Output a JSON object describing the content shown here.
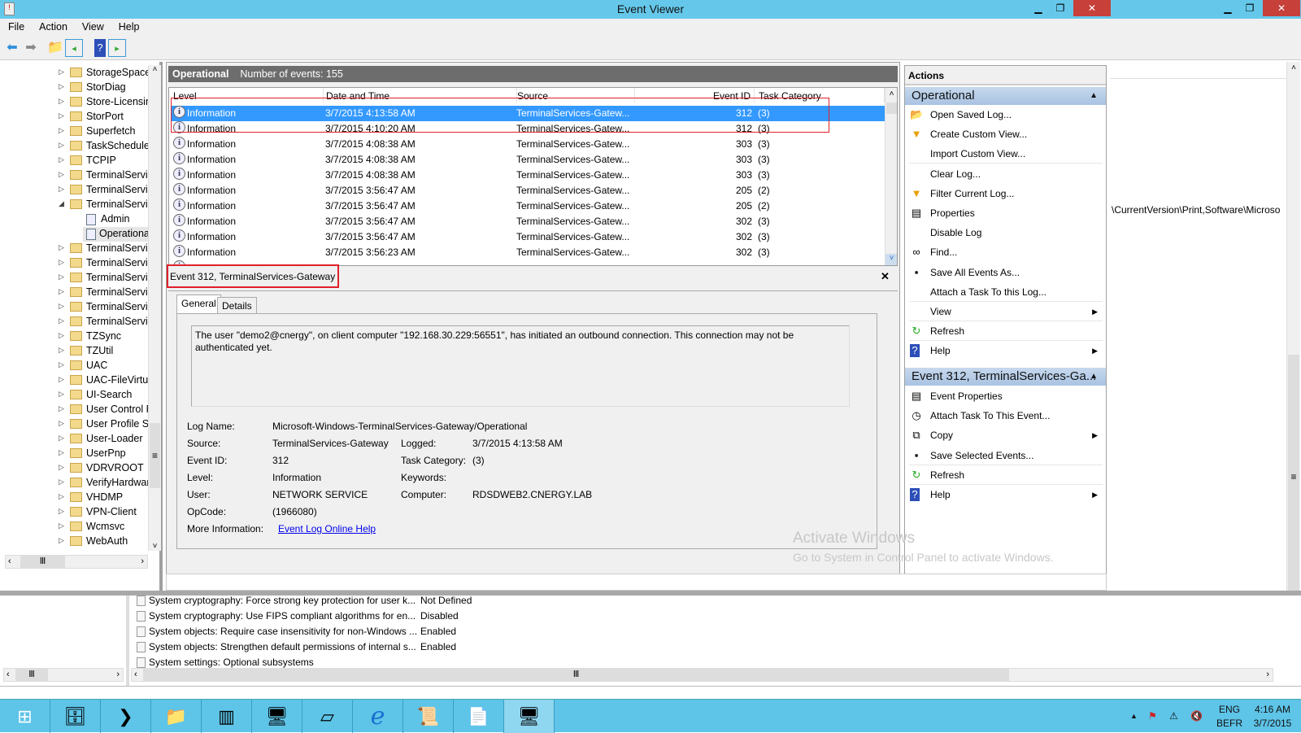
{
  "window": {
    "title": "Event Viewer"
  },
  "menu": [
    "File",
    "Action",
    "View",
    "Help"
  ],
  "tree": [
    {
      "label": "StorageSpaces",
      "kind": "folder"
    },
    {
      "label": "StorDiag",
      "kind": "folder"
    },
    {
      "label": "Store-Licensin",
      "kind": "folder"
    },
    {
      "label": "StorPort",
      "kind": "folder"
    },
    {
      "label": "Superfetch",
      "kind": "folder"
    },
    {
      "label": "TaskScheduler",
      "kind": "folder"
    },
    {
      "label": "TCPIP",
      "kind": "folder"
    },
    {
      "label": "TerminalServic",
      "kind": "folder"
    },
    {
      "label": "TerminalServic",
      "kind": "folder"
    },
    {
      "label": "TerminalServic",
      "kind": "folder-open"
    },
    {
      "label": "Admin",
      "kind": "log"
    },
    {
      "label": "Operationa",
      "kind": "log-selected"
    },
    {
      "label": "TerminalServic",
      "kind": "folder"
    },
    {
      "label": "TerminalServic",
      "kind": "folder"
    },
    {
      "label": "TerminalServic",
      "kind": "folder"
    },
    {
      "label": "TerminalServic",
      "kind": "folder"
    },
    {
      "label": "TerminalServic",
      "kind": "folder"
    },
    {
      "label": "TerminalServic",
      "kind": "folder"
    },
    {
      "label": "TZSync",
      "kind": "folder"
    },
    {
      "label": "TZUtil",
      "kind": "folder"
    },
    {
      "label": "UAC",
      "kind": "folder"
    },
    {
      "label": "UAC-FileVirtua",
      "kind": "folder"
    },
    {
      "label": "UI-Search",
      "kind": "folder"
    },
    {
      "label": "User Control P",
      "kind": "folder"
    },
    {
      "label": "User Profile Se",
      "kind": "folder"
    },
    {
      "label": "User-Loader",
      "kind": "folder"
    },
    {
      "label": "UserPnp",
      "kind": "folder"
    },
    {
      "label": "VDRVROOT",
      "kind": "folder"
    },
    {
      "label": "VerifyHardwar",
      "kind": "folder"
    },
    {
      "label": "VHDMP",
      "kind": "folder"
    },
    {
      "label": "VPN-Client",
      "kind": "folder"
    },
    {
      "label": "Wcmsvc",
      "kind": "folder"
    },
    {
      "label": "WebAuth",
      "kind": "folder"
    }
  ],
  "log": {
    "name": "Operational",
    "count_text": "Number of events: 155"
  },
  "columns": [
    "Level",
    "Date and Time",
    "Source",
    "Event ID",
    "Task Category"
  ],
  "events": [
    {
      "level": "Information",
      "date": "3/7/2015 4:13:58 AM",
      "source": "TerminalServices-Gatew...",
      "id": "312",
      "cat": "(3)"
    },
    {
      "level": "Information",
      "date": "3/7/2015 4:10:20 AM",
      "source": "TerminalServices-Gatew...",
      "id": "312",
      "cat": "(3)"
    },
    {
      "level": "Information",
      "date": "3/7/2015 4:08:38 AM",
      "source": "TerminalServices-Gatew...",
      "id": "303",
      "cat": "(3)"
    },
    {
      "level": "Information",
      "date": "3/7/2015 4:08:38 AM",
      "source": "TerminalServices-Gatew...",
      "id": "303",
      "cat": "(3)"
    },
    {
      "level": "Information",
      "date": "3/7/2015 4:08:38 AM",
      "source": "TerminalServices-Gatew...",
      "id": "303",
      "cat": "(3)"
    },
    {
      "level": "Information",
      "date": "3/7/2015 3:56:47 AM",
      "source": "TerminalServices-Gatew...",
      "id": "205",
      "cat": "(2)"
    },
    {
      "level": "Information",
      "date": "3/7/2015 3:56:47 AM",
      "source": "TerminalServices-Gatew...",
      "id": "205",
      "cat": "(2)"
    },
    {
      "level": "Information",
      "date": "3/7/2015 3:56:47 AM",
      "source": "TerminalServices-Gatew...",
      "id": "302",
      "cat": "(3)"
    },
    {
      "level": "Information",
      "date": "3/7/2015 3:56:47 AM",
      "source": "TerminalServices-Gatew...",
      "id": "302",
      "cat": "(3)"
    },
    {
      "level": "Information",
      "date": "3/7/2015 3:56:23 AM",
      "source": "TerminalServices-Gatew...",
      "id": "302",
      "cat": "(3)"
    }
  ],
  "detail": {
    "title": "Event 312, TerminalServices-Gateway",
    "tabs": [
      "General",
      "Details"
    ],
    "message": "The user \"demo2@cnergy\", on client computer \"192.168.30.229:56551\", has initiated an outbound connection. This connection may not be authenticated yet.",
    "log_name_label": "Log Name:",
    "log_name": "Microsoft-Windows-TerminalServices-Gateway/Operational",
    "source_label": "Source:",
    "source": "TerminalServices-Gateway",
    "logged_label": "Logged:",
    "logged": "3/7/2015 4:13:58 AM",
    "event_id_label": "Event ID:",
    "event_id": "312",
    "task_label": "Task Category:",
    "task": "(3)",
    "level_label": "Level:",
    "level": "Information",
    "keywords_label": "Keywords:",
    "user_label": "User:",
    "user": "NETWORK SERVICE",
    "computer_label": "Computer:",
    "computer": "RDSDWEB2.CNERGY.LAB",
    "opcode_label": "OpCode:",
    "opcode": "(1966080)",
    "more_label": "More Information:",
    "more_link": "Event Log Online Help"
  },
  "actions": {
    "title": "Actions",
    "section1": "Operational",
    "items1": [
      {
        "label": "Open Saved Log...",
        "icon": "folder-open-icon",
        "glyph": "📂"
      },
      {
        "label": "Create Custom View...",
        "icon": "funnel-star-icon",
        "glyph": "▼"
      },
      {
        "label": "Import Custom View...",
        "icon": "",
        "glyph": ""
      },
      {
        "label": "Clear Log...",
        "icon": "",
        "glyph": ""
      },
      {
        "label": "Filter Current Log...",
        "icon": "funnel-icon",
        "glyph": "▼"
      },
      {
        "label": "Properties",
        "icon": "properties-icon",
        "glyph": "▤"
      },
      {
        "label": "Disable Log",
        "icon": "",
        "glyph": ""
      },
      {
        "label": "Find...",
        "icon": "binoculars-icon",
        "glyph": "∞"
      },
      {
        "label": "Save All Events As...",
        "icon": "save-icon",
        "glyph": "▪"
      },
      {
        "label": "Attach a Task To this Log...",
        "icon": "",
        "glyph": ""
      },
      {
        "label": "View",
        "icon": "",
        "glyph": "",
        "sub": true
      },
      {
        "label": "Refresh",
        "icon": "refresh-icon",
        "glyph": "↻"
      },
      {
        "label": "Help",
        "icon": "help-icon",
        "glyph": "?",
        "sub": true
      }
    ],
    "section2": "Event 312, TerminalServices-Ga...",
    "items2": [
      {
        "label": "Event Properties",
        "icon": "properties-icon",
        "glyph": "▤"
      },
      {
        "label": "Attach Task To This Event...",
        "icon": "clock-icon",
        "glyph": "◷"
      },
      {
        "label": "Copy",
        "icon": "copy-icon",
        "glyph": "⧉",
        "sub": true
      },
      {
        "label": "Save Selected Events...",
        "icon": "save-icon",
        "glyph": "▪"
      },
      {
        "label": "Refresh",
        "icon": "refresh-icon",
        "glyph": "↻"
      },
      {
        "label": "Help",
        "icon": "help-icon",
        "glyph": "?",
        "sub": true
      }
    ]
  },
  "watermark": {
    "line1": "Activate Windows",
    "line2": "Go to System in Control Panel to activate Windows."
  },
  "background": {
    "path_text": "\\CurrentVersion\\Print,Software\\Microso",
    "rows": [
      {
        "name": "System cryptography: Force strong key protection for user k...",
        "value": "Not Defined"
      },
      {
        "name": "System cryptography: Use FIPS compliant algorithms for en...",
        "value": "Disabled"
      },
      {
        "name": "System objects: Require case insensitivity for non-Windows ...",
        "value": "Enabled"
      },
      {
        "name": "System objects: Strengthen default permissions of internal s...",
        "value": "Enabled"
      },
      {
        "name": "System settings: Optional subsystems",
        "value": ""
      }
    ]
  },
  "taskbar": {
    "apps": [
      "start",
      "server-manager",
      "powershell",
      "file-explorer",
      "server-cluster",
      "network-computer",
      "notepad-pad",
      "internet-explorer",
      "script",
      "notepad",
      "remote-desktop"
    ],
    "lang1": "ENG",
    "lang2": "BEFR",
    "time": "4:16 AM",
    "date": "3/7/2015"
  },
  "colors": {
    "titlebar": "#65c8ea",
    "selection": "#3399ff",
    "highlight_box": "#e0202a",
    "taskbar": "#5ec4e8"
  }
}
